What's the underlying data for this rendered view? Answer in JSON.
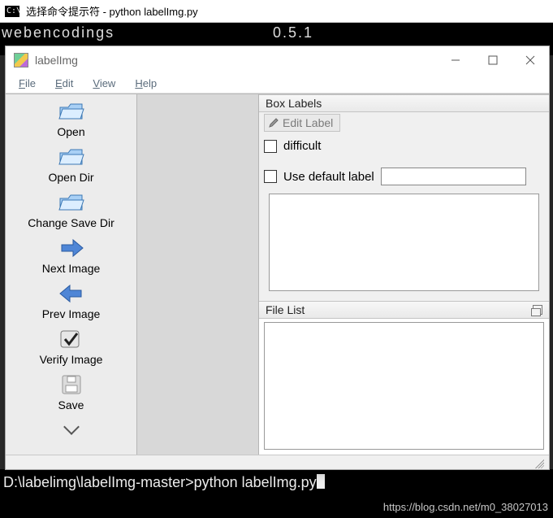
{
  "cmd": {
    "title": "选择命令提示符 - python  labelImg.py",
    "bg_line_left": "webencodings",
    "bg_line_right": "0.5.1",
    "prompt": "D:\\labelimg\\labelImg-master>python labelImg.py"
  },
  "app": {
    "title": "labelImg"
  },
  "menu": {
    "file": "File",
    "edit": "Edit",
    "view": "View",
    "help": "Help"
  },
  "tools": {
    "open": "Open",
    "open_dir": "Open Dir",
    "change_save_dir": "Change Save Dir",
    "next_image": "Next Image",
    "prev_image": "Prev Image",
    "verify_image": "Verify Image",
    "save": "Save"
  },
  "panels": {
    "box_labels": "Box Labels",
    "edit_label": "Edit Label",
    "difficult": "difficult",
    "use_default_label": "Use default label",
    "file_list": "File List"
  },
  "watermark": "https://blog.csdn.net/m0_38027013"
}
